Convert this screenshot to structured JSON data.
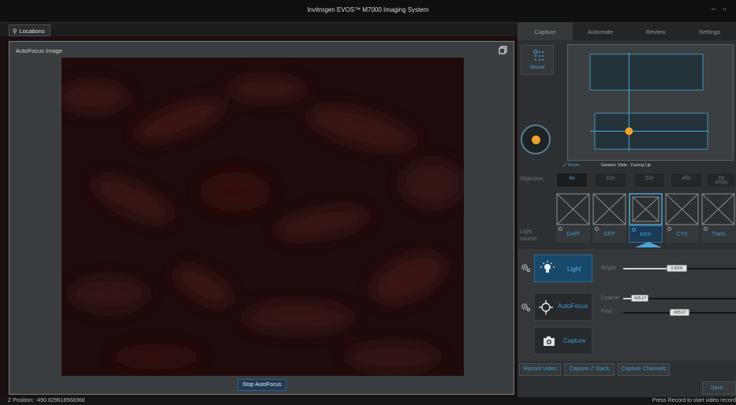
{
  "window": {
    "title": "Invitrogen EVOS™ M7000 Imaging System",
    "minimize_label": "–",
    "maximize_label": "▫"
  },
  "locations_tab": {
    "label": "Locations"
  },
  "autofocus_panel": {
    "title": "AutoFocus Image",
    "stop_button": "Stop AutoFocus"
  },
  "status_bar": {
    "z_position": "Z Position: -490.829618568368",
    "record_hint": "Press Record to start video record"
  },
  "tabs": [
    {
      "label": "Capture",
      "active": true
    },
    {
      "label": "Automate",
      "active": false
    },
    {
      "label": "Review",
      "active": false
    },
    {
      "label": "Settings",
      "active": false
    }
  ],
  "vessel": {
    "label": "Vessel"
  },
  "map": {
    "zoom_label": "Zoom",
    "slide_label": "Generic Slide - Facing Up",
    "marker_color": "#f0a422"
  },
  "objective": {
    "label": "Objective:",
    "options": [
      {
        "label": "4x",
        "sub": "",
        "active": true
      },
      {
        "label": "10x",
        "sub": "",
        "active": false
      },
      {
        "label": "20x",
        "sub": "",
        "active": false
      },
      {
        "label": "40x",
        "sub": "",
        "active": false
      },
      {
        "label": "0x",
        "sub": "empty",
        "active": false
      }
    ]
  },
  "light_source": {
    "label_line1": "Light",
    "label_line2": "source:",
    "options": [
      {
        "label": "DAPI",
        "active": false
      },
      {
        "label": "GFP",
        "active": false
      },
      {
        "label": "RFP",
        "active": true
      },
      {
        "label": "CY5",
        "active": false
      },
      {
        "label": "Trans",
        "active": false
      }
    ],
    "accent": "#4aa8d8"
  },
  "light_control": {
    "button": "Light",
    "bright_label": "Bright:",
    "bright_value": "0.0000"
  },
  "autofocus_control": {
    "button": "AutoFocus",
    "coarse_label": "Coarse:",
    "coarse_value": "-905.07",
    "fine_label": "Fine:",
    "fine_value": "-905.07"
  },
  "capture_control": {
    "button": "Capture"
  },
  "actions": {
    "record_video": "Record Video",
    "capture_z_stack": "Capture Z Stack",
    "capture_channels": "Capture Channels",
    "save": "Save..."
  }
}
